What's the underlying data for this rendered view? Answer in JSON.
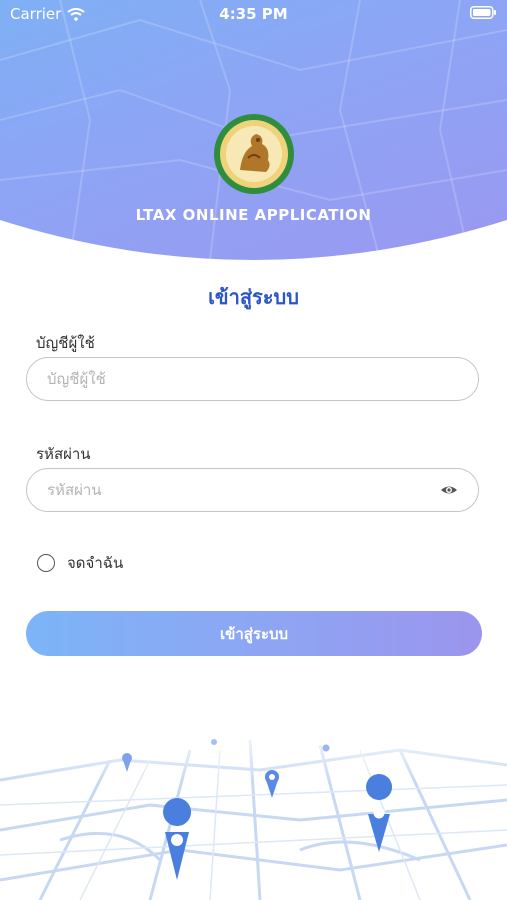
{
  "status_bar": {
    "carrier": "Carrier",
    "time": "4:35 PM"
  },
  "header": {
    "app_title": "LTAX ONLINE APPLICATION",
    "logo_icon": "government-seal-logo"
  },
  "form": {
    "title": "เข้าสู่ระบบ",
    "username": {
      "label": "บัญชีผู้ใช้",
      "placeholder": "บัญชีผู้ใช้",
      "value": ""
    },
    "password": {
      "label": "รหัสผ่าน",
      "placeholder": "รหัสผ่าน",
      "value": "",
      "toggle_icon": "eye-icon"
    },
    "remember": {
      "label": "จดจำฉัน",
      "checked": false
    },
    "submit_label": "เข้าสู่ระบบ"
  },
  "colors": {
    "header_start": "#7fb0f5",
    "header_end": "#9a98f0",
    "title_blue": "#2b56c8",
    "button_start": "#7cb4f7",
    "button_end": "#9b95ee"
  }
}
